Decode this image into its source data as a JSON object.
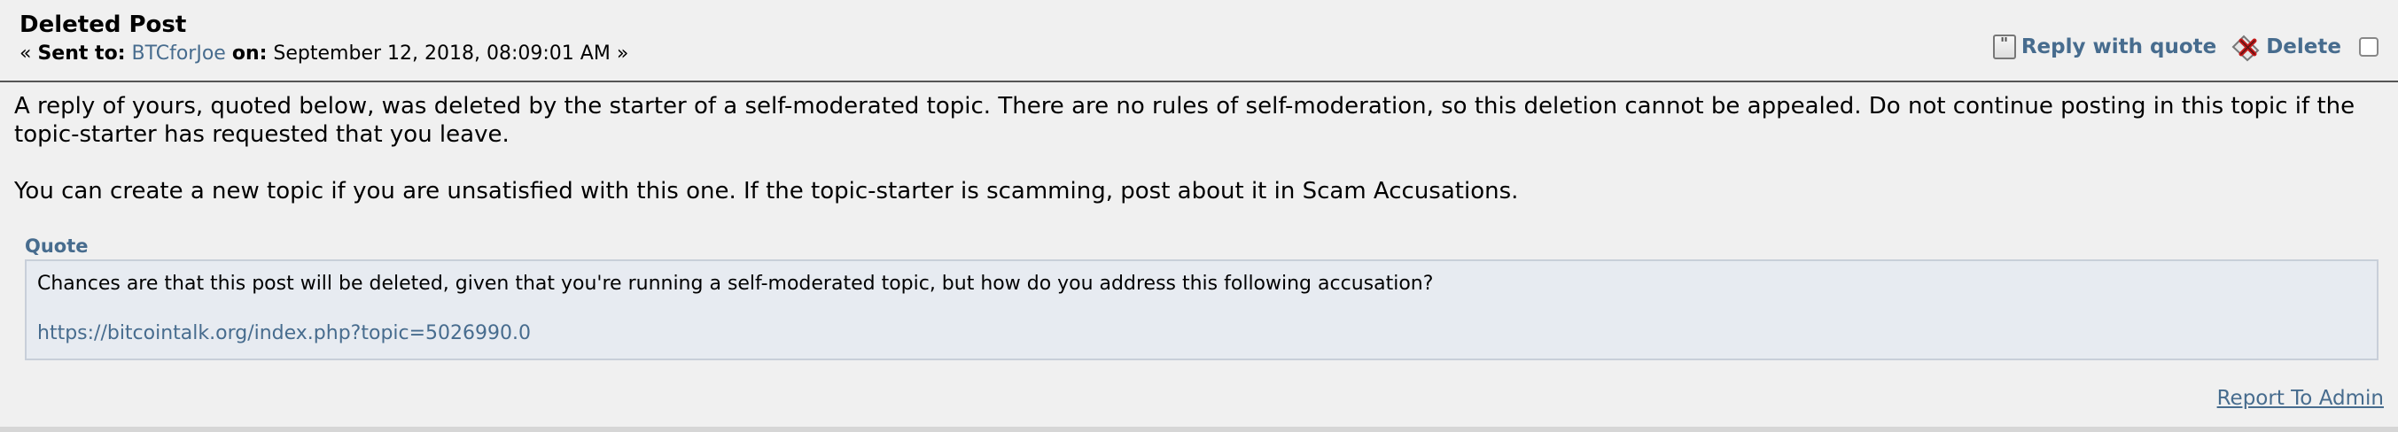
{
  "post": {
    "title": "Deleted Post",
    "meta": {
      "prefix": "« ",
      "sent_to_label": "Sent to:",
      "recipient": "BTCforJoe",
      "on_label": "on:",
      "timestamp": "September 12, 2018, 08:09:01 AM",
      "suffix": "»"
    },
    "actions": {
      "reply_with_quote": "Reply with quote",
      "delete": "Delete"
    },
    "body": {
      "paragraph_1": "A reply of yours, quoted below, was deleted by the starter of a self-moderated topic. There are no rules of self-moderation, so this deletion cannot be appealed. Do not continue posting in this topic if the topic-starter has requested that you leave.",
      "paragraph_2": "You can create a new topic if you are unsatisfied with this one. If the topic-starter is scamming, post about it in Scam Accusations."
    },
    "quote": {
      "label": "Quote",
      "text": "Chances are that this post will be deleted, given that you're running a self-moderated topic, but how do you address this following accusation?",
      "url": "https://bitcointalk.org/index.php?topic=5026990.0"
    },
    "report_link": "Report To Admin"
  },
  "colors": {
    "link": "#476c8e",
    "background": "#f0f0f0",
    "quote_background": "#e7ebf1"
  }
}
